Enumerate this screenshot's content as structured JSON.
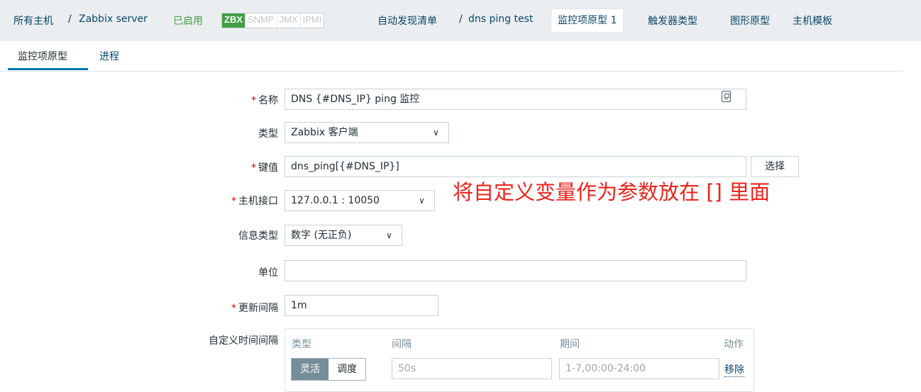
{
  "breadcrumb": {
    "all_hosts": "所有主机",
    "separator": "/",
    "host": "Zabbix server",
    "status": "已启用",
    "badges": [
      "ZBX",
      "SNMP",
      "JMX",
      "IPMI"
    ],
    "discovery_list": "自动发现清单",
    "rule": "dns ping test",
    "tabs": [
      {
        "label": "监控项原型 1",
        "active": true
      },
      {
        "label": "触发器类型"
      },
      {
        "label": "图形原型"
      },
      {
        "label": "主机模板"
      }
    ]
  },
  "subtabs": [
    "监控项原型",
    "进程"
  ],
  "form": {
    "name_label": "名称",
    "name_value": "DNS {#DNS_IP} ping 监控",
    "type_label": "类型",
    "type_value": "Zabbix 客户端",
    "key_label": "键值",
    "key_value": "dns_ping[{#DNS_IP}]",
    "select_button": "选择",
    "interface_label": "主机接口",
    "interface_value": "127.0.0.1 : 10050",
    "info_type_label": "信息类型",
    "info_type_value": "数字 (无正负)",
    "units_label": "单位",
    "units_value": "",
    "update_label": "更新间隔",
    "update_value": "1m",
    "custom_label": "自定义时间间隔",
    "custom_headers": [
      "类型",
      "间隔",
      "期间",
      "动作"
    ],
    "custom_modes": [
      "灵活",
      "调度"
    ],
    "custom_interval_placeholder": "50s",
    "custom_period_placeholder": "1-7,00:00-24:00",
    "remove_link": "移除",
    "required_mark": "*"
  },
  "annotation": "将自定义变量作为参数放在 [] 里面",
  "colors": {
    "accent": "#0275b8",
    "enabled": "#429e47",
    "annotation": "#e8251d",
    "required": "#d40000"
  }
}
